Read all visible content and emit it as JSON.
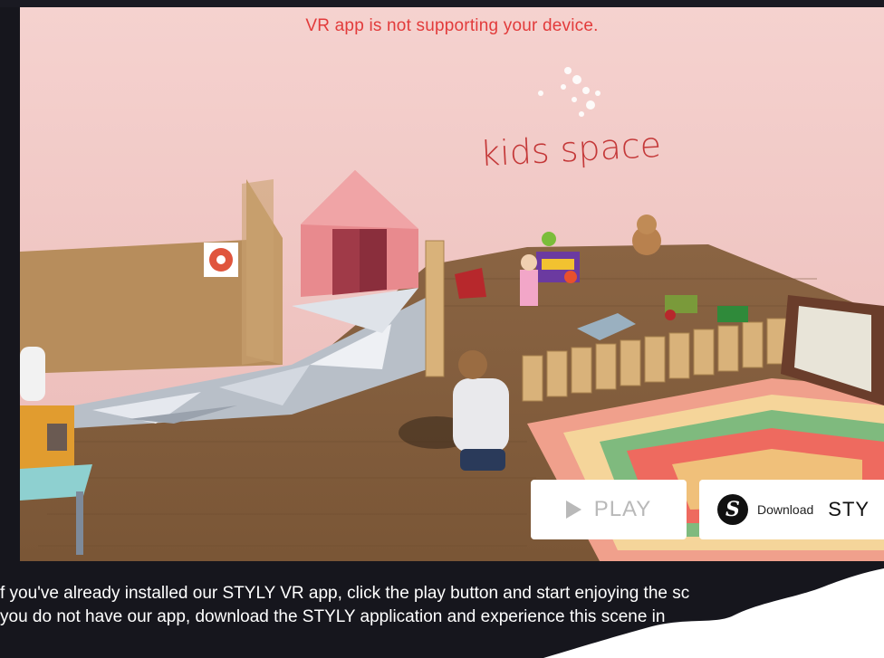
{
  "scene": {
    "warning": "VR app is not supporting your device.",
    "title_3d": "kids space"
  },
  "buttons": {
    "play_label": "PLAY",
    "download_label": "Download",
    "download_brand": "STY"
  },
  "info": {
    "line1": "f you've already installed our STYLY VR app, click the play button and start enjoying the sc",
    "line2": "you do not have our app, download the STYLY application and experience this scene in"
  },
  "colors": {
    "warning": "#e23b3b",
    "background_dark": "#16161d",
    "wall_pink": "#f3c9c6"
  }
}
